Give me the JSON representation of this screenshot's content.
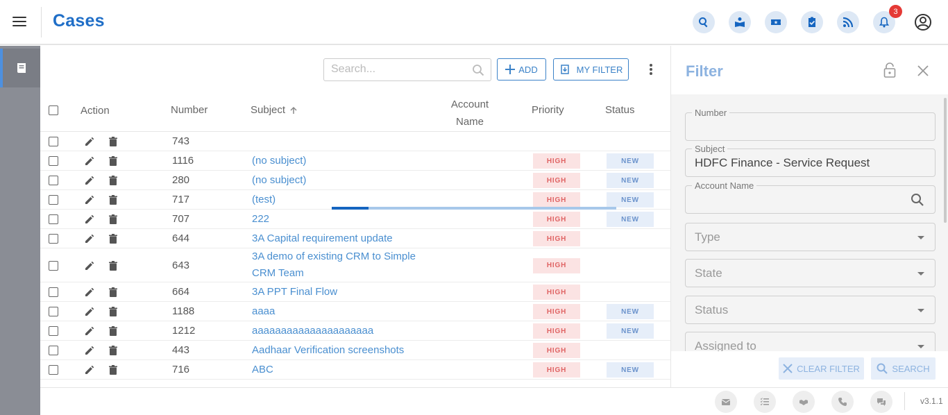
{
  "header": {
    "title": "Cases",
    "notification_count": "3",
    "icons": [
      "search-icon",
      "book-reader-icon",
      "ticket-icon",
      "clipboard-check-icon",
      "rss-icon",
      "bell-icon",
      "account-icon"
    ]
  },
  "toolbar": {
    "search_placeholder": "Search...",
    "add_label": "ADD",
    "my_filter_label": "MY FILTER"
  },
  "table": {
    "columns": {
      "action": "Action",
      "number": "Number",
      "subject": "Subject",
      "account_name_1": "Account",
      "account_name_2": "Name",
      "priority": "Priority",
      "status": "Status"
    },
    "rows": [
      {
        "number": "743",
        "subject": "",
        "priority": "",
        "status": ""
      },
      {
        "number": "1116",
        "subject": "(no subject)",
        "priority": "HIGH",
        "status": "NEW"
      },
      {
        "number": "280",
        "subject": "(no subject)",
        "priority": "HIGH",
        "status": "NEW"
      },
      {
        "number": "717",
        "subject": "(test)",
        "priority": "HIGH",
        "status": "NEW"
      },
      {
        "number": "707",
        "subject": "222",
        "priority": "HIGH",
        "status": "NEW"
      },
      {
        "number": "644",
        "subject": "3A Capital requirement update",
        "priority": "HIGH",
        "status": ""
      },
      {
        "number": "643",
        "subject": "3A demo of existing CRM to Simple CRM Team",
        "priority": "HIGH",
        "status": ""
      },
      {
        "number": "664",
        "subject": "3A PPT Final Flow",
        "priority": "HIGH",
        "status": ""
      },
      {
        "number": "1188",
        "subject": "aaaa",
        "priority": "HIGH",
        "status": "NEW"
      },
      {
        "number": "1212",
        "subject": "aaaaaaaaaaaaaaaaaaaaa",
        "priority": "HIGH",
        "status": "NEW"
      },
      {
        "number": "443",
        "subject": "Aadhaar Verification screenshots",
        "priority": "HIGH",
        "status": ""
      },
      {
        "number": "716",
        "subject": "ABC",
        "priority": "HIGH",
        "status": "NEW"
      }
    ]
  },
  "filter": {
    "title": "Filter",
    "fields": {
      "number_label": "Number",
      "number_value": "",
      "subject_label": "Subject",
      "subject_value": "HDFC Finance - Service Request",
      "account_name_label": "Account Name",
      "account_name_value": "",
      "type_placeholder": "Type",
      "state_placeholder": "State",
      "status_placeholder": "Status",
      "assigned_to_placeholder": "Assigned to"
    },
    "clear_label": "CLEAR FILTER",
    "search_label": "SEARCH"
  },
  "footer": {
    "icons": [
      "email-icon",
      "tasks-icon",
      "handshake-icon",
      "phone-icon",
      "chat-icon"
    ],
    "version": "v3.1.1"
  },
  "colors": {
    "brand": "#1f6ec7",
    "link": "#4a8fd0",
    "high": "#e06464",
    "new": "#6b93cc"
  }
}
